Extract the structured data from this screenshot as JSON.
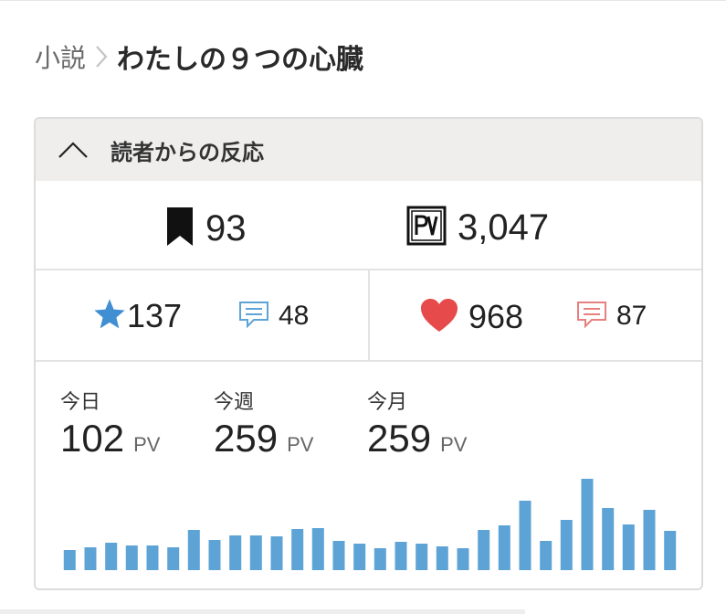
{
  "breadcrumb": {
    "parent": "小説",
    "current": "わたしの９つの心臓"
  },
  "panel": {
    "title": "読者からの反応"
  },
  "stats": {
    "bookmarks": "93",
    "pv_total": "3,047",
    "stars": "137",
    "star_comments": "48",
    "hearts": "968",
    "heart_comments": "87"
  },
  "pv": {
    "today": {
      "label": "今日",
      "value": "102",
      "unit": "PV"
    },
    "week": {
      "label": "今週",
      "value": "259",
      "unit": "PV"
    },
    "month": {
      "label": "今月",
      "value": "259",
      "unit": "PV"
    }
  },
  "colors": {
    "bar": "#5da3d6",
    "star": "#3f8fd2",
    "heart": "#e64a4a",
    "heart_comment": "#e88080",
    "star_comment": "#5da3d6"
  },
  "icons": {
    "bookmark": "bookmark-icon",
    "pv": "pv-icon",
    "star": "star-icon",
    "heart": "heart-icon",
    "comment": "comment-icon",
    "collapse": "chevron-up-icon",
    "breadcrumb_separator": "chevron-right-icon"
  },
  "chart_data": {
    "type": "bar",
    "values": [
      22,
      25,
      30,
      27,
      27,
      25,
      44,
      33,
      38,
      38,
      37,
      45,
      46,
      32,
      29,
      24,
      31,
      29,
      26,
      24,
      44,
      49,
      76,
      32,
      55,
      100,
      68,
      50,
      66,
      43
    ]
  }
}
